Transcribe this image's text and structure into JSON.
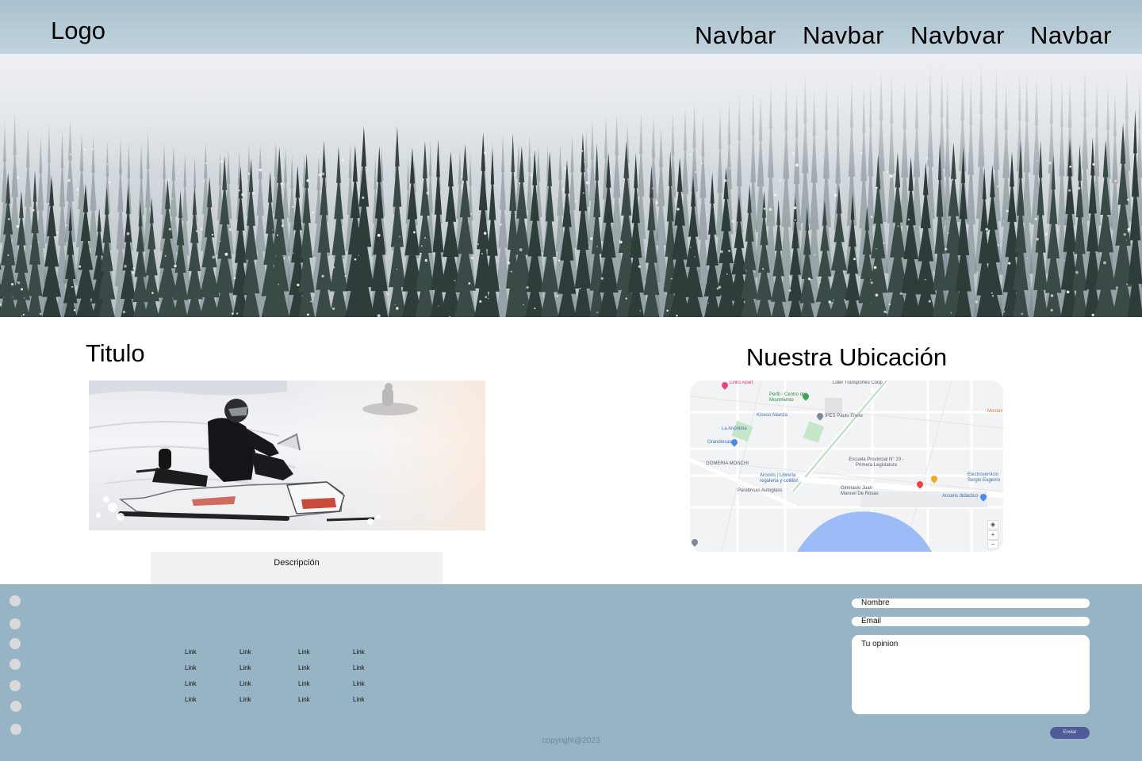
{
  "header": {
    "logo": "Logo",
    "nav": [
      "Navbar",
      "Navbar",
      "Navbvar",
      "Navbar"
    ]
  },
  "hero": {
    "image": "snowy-foggy-pine-forest"
  },
  "content": {
    "title": "Titulo",
    "image": "snowmobile-rider-in-snow",
    "description": "Descripción",
    "location_title": "Nuestra Ubicación"
  },
  "map": {
    "labels": [
      "Links Apart",
      "Lider Transportes Coop",
      "Perfil - Centro del Movimiento",
      "Kiosco Alianza",
      "IPES Paulo Freire",
      "La Anónima",
      "Grandiosas",
      "GOMERIA MONCHI",
      "Escuela Provincial N° 19 - Primera Legislatura",
      "Arcoiris | Librería regalería y cotillón",
      "Parabrisas Autoglass",
      "Gimnasio Juan Manuel De Rosas",
      "Arcoiris didáctico",
      "Electroservicio Sergio Eugenio",
      "Mostaz"
    ],
    "controls": [
      "+",
      "−"
    ]
  },
  "footer": {
    "links": [
      [
        "Link",
        "Link",
        "Link",
        "Link"
      ],
      [
        "Link",
        "Link",
        "Link",
        "Link"
      ],
      [
        "Link",
        "Link",
        "Link",
        "Link"
      ],
      [
        "Link",
        "Link",
        "Link",
        "Link"
      ]
    ],
    "form": {
      "name_placeholder": "Nombre",
      "email_placeholder": "Email",
      "opinion_placeholder": "Tu opinion",
      "submit": "Enviar"
    },
    "copyright": "copyright@2023"
  },
  "colors": {
    "header": "#a8c1ce",
    "footer": "#97b4c4",
    "button": "#4e5d9a",
    "social_dot": "#d9d9d9"
  }
}
